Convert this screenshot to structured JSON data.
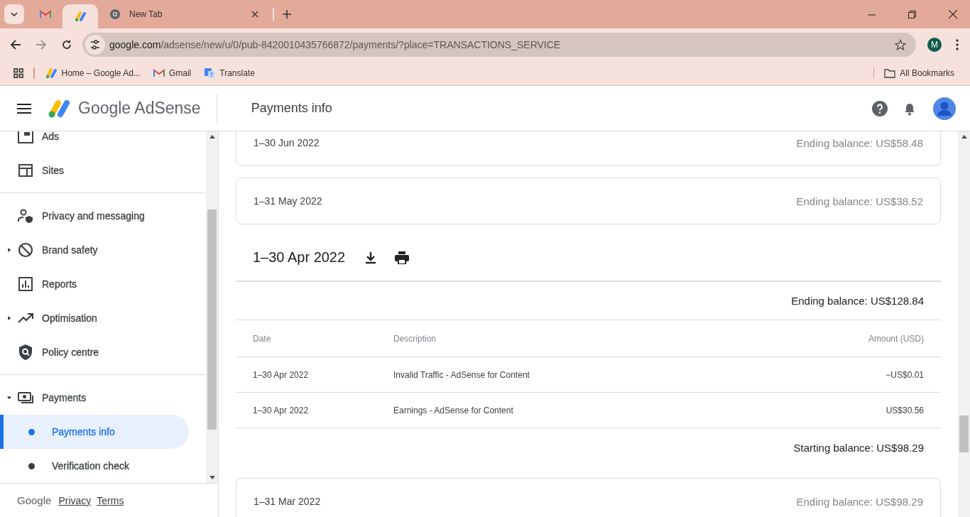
{
  "browser": {
    "tabs": [
      {
        "kind": "gmail",
        "selected": false
      },
      {
        "kind": "adsense",
        "selected": true
      },
      {
        "kind": "chrome",
        "label": "New Tab",
        "selected": false
      }
    ],
    "address": {
      "host": "google.com",
      "path": "/adsense/new/u/0/pub-8420010435766872/payments/?place=TRANSACTIONS_SERVICE"
    },
    "profile_initial": "M",
    "bookmarks": [
      {
        "kind": "adsense",
        "label": "Home – Google Ad..."
      },
      {
        "kind": "gmail",
        "label": "Gmail"
      },
      {
        "kind": "translate",
        "label": "Translate"
      }
    ],
    "all_bookmarks": "All Bookmarks"
  },
  "app": {
    "product": "Google AdSense",
    "page_title": "Payments info"
  },
  "sidebar": {
    "sections": [
      {
        "items": [
          {
            "kind": "ads",
            "label": "Ads"
          },
          {
            "kind": "sites",
            "label": "Sites"
          }
        ]
      },
      {
        "items": [
          {
            "kind": "privacy",
            "label": "Privacy and messaging"
          },
          {
            "kind": "brand",
            "label": "Brand safety",
            "expanded": false
          },
          {
            "kind": "reports",
            "label": "Reports"
          },
          {
            "kind": "optimisation",
            "label": "Optimisation",
            "expanded": false
          },
          {
            "kind": "policy",
            "label": "Policy centre"
          }
        ]
      },
      {
        "items": [
          {
            "kind": "payments",
            "label": "Payments",
            "expanded": true,
            "children": [
              {
                "label": "Payments info",
                "selected": true
              },
              {
                "label": "Verification check",
                "selected": false
              }
            ]
          }
        ]
      }
    ],
    "footer": {
      "brand": "Google",
      "links": [
        "Privacy",
        "Terms"
      ]
    }
  },
  "periods": [
    {
      "kind": "collapsed",
      "dates": "1–30 Jun 2022",
      "ending_balance": "Ending balance: US$58.48"
    },
    {
      "kind": "collapsed",
      "dates": "1–31 May 2022",
      "ending_balance": "Ending balance: US$38.52"
    },
    {
      "kind": "expanded",
      "dates": "1–30 Apr 2022",
      "ending_balance": "Ending balance: US$128.84",
      "columns": [
        "Date",
        "Description",
        "Amount (USD)"
      ],
      "rows": [
        [
          "1–30 Apr 2022",
          "Invalid Traffic - AdSense for Content",
          "−US$0.01"
        ],
        [
          "1–30 Apr 2022",
          "Earnings - AdSense for Content",
          "US$30.56"
        ]
      ],
      "starting_balance": "Starting balance: US$98.29"
    },
    {
      "kind": "collapsed",
      "dates": "1–31 Mar 2022",
      "ending_balance": "Ending balance: US$98.29"
    }
  ]
}
